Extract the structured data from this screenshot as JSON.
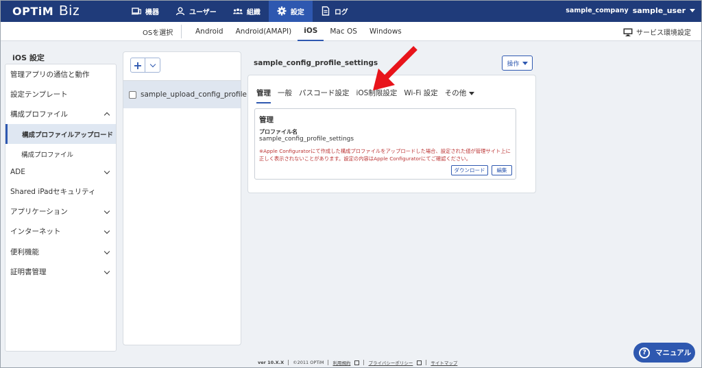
{
  "header": {
    "logo_brand": "OPTiM",
    "logo_product": "Biz",
    "nav": [
      {
        "label": "機器",
        "icon": "device-icon"
      },
      {
        "label": "ユーザー",
        "icon": "user-icon"
      },
      {
        "label": "組織",
        "icon": "group-icon"
      },
      {
        "label": "設定",
        "icon": "gear-icon"
      },
      {
        "label": "ログ",
        "icon": "log-icon"
      }
    ],
    "active_nav": "設定",
    "company": "sample_company",
    "user": "sample_user"
  },
  "os_bar": {
    "select_label": "OSを選択",
    "tabs": [
      "Android",
      "Android(AMAPI)",
      "iOS",
      "Mac OS",
      "Windows"
    ],
    "active_tab": "iOS",
    "service_settings": "サービス環境設定"
  },
  "sidebar": {
    "title": "iOS 設定",
    "items": [
      {
        "label": "管理アプリの通信と動作"
      },
      {
        "label": "設定テンプレート"
      },
      {
        "label": "構成プロファイル"
      },
      {
        "label": "構成プロファイルアップロード"
      },
      {
        "label": "構成プロファイル"
      },
      {
        "label": "ADE"
      },
      {
        "label": "Shared iPadセキュリティ"
      },
      {
        "label": "アプリケーション"
      },
      {
        "label": "インターネット"
      },
      {
        "label": "便利機能"
      },
      {
        "label": "証明書管理"
      }
    ]
  },
  "list": {
    "add_label": "+",
    "rows": [
      {
        "label": "sample_upload_config_profile"
      }
    ]
  },
  "detail": {
    "title": "sample_config_profile_settings",
    "action_label": "操作",
    "tabs": [
      "管理",
      "一般",
      "パスコード設定",
      "iOS制限設定",
      "Wi-Fi 設定",
      "その他"
    ],
    "active_tab": "管理",
    "card": {
      "heading": "管理",
      "profile_name_label": "プロファイル名",
      "profile_name_value": "sample_config_profile_settings",
      "warning": "※Apple Configuratorにて作成した構成プロファイルをアップロードした場合、設定された値が管理サイト上に正しく表示されないことがあります。設定の内容はApple Configuratorにてご確認ください。",
      "download_label": "ダウンロード",
      "edit_label": "編集"
    }
  },
  "footer": {
    "version": "ver 10.X.X",
    "copyright": "©2011 OPTiM",
    "terms": "利用規約",
    "privacy": "プライバシーポリシー",
    "sitemap": "サイトマップ"
  },
  "manual_button": "マニュアル",
  "colors": {
    "nav_bg": "#1f3b7a",
    "accent": "#2e58b0",
    "warning": "#b33333",
    "annotation_arrow": "#e8141b"
  }
}
